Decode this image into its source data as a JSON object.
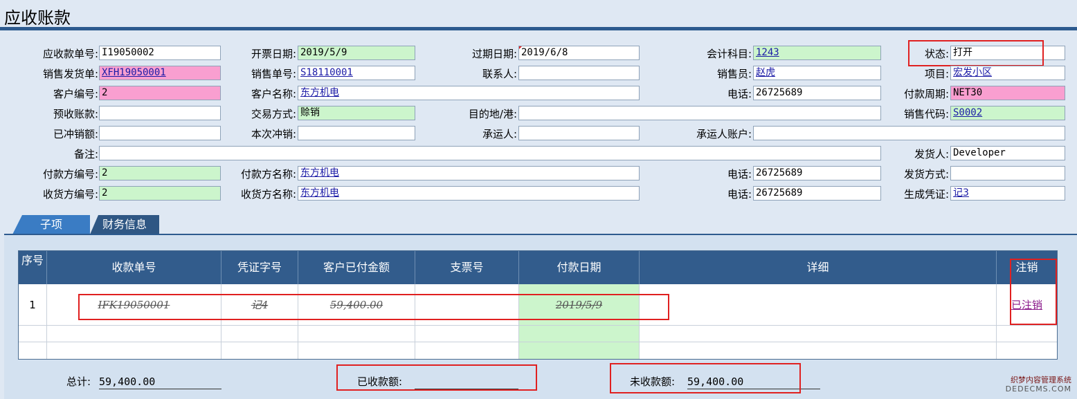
{
  "page_title": "应收账款",
  "form": {
    "receivable_no": {
      "label": "应收款单号:",
      "value": "I19050002"
    },
    "invoice_date": {
      "label": "开票日期:",
      "value": "2019/5/9"
    },
    "due_date": {
      "label": "过期日期:",
      "value": "2019/6/8"
    },
    "account_subject": {
      "label": "会计科目:",
      "value": "1243"
    },
    "status": {
      "label": "状态:",
      "value": "打开"
    },
    "sales_delivery": {
      "label": "销售发货单:",
      "value": "XFH19050001"
    },
    "sales_order": {
      "label": "销售单号:",
      "value": "S18110001"
    },
    "contact": {
      "label": "联系人:",
      "value": ""
    },
    "salesperson": {
      "label": "销售员:",
      "value": "赵虎"
    },
    "project": {
      "label": "项目:",
      "value": "宏发小区"
    },
    "customer_no": {
      "label": "客户编号:",
      "value": "2"
    },
    "customer_name": {
      "label": "客户名称:",
      "value": "东方机电"
    },
    "phone1": {
      "label": "电话:",
      "value": "26725689"
    },
    "payment_term": {
      "label": "付款周期:",
      "value": "NET30"
    },
    "prepaid": {
      "label": "预收账款:",
      "value": ""
    },
    "trade_mode": {
      "label": "交易方式:",
      "value": "赊销"
    },
    "destination": {
      "label": "目的地/港:",
      "value": ""
    },
    "sales_code": {
      "label": "销售代码:",
      "value": "S0002"
    },
    "offset_amount": {
      "label": "已冲销额:",
      "value": ""
    },
    "current_offset": {
      "label": "本次冲销:",
      "value": ""
    },
    "carrier": {
      "label": "承运人:",
      "value": ""
    },
    "carrier_account": {
      "label": "承运人账户:",
      "value": ""
    },
    "remark": {
      "label": "备注:",
      "value": ""
    },
    "shipper": {
      "label": "发货人:",
      "value": "Developer"
    },
    "payer_no": {
      "label": "付款方编号:",
      "value": "2"
    },
    "payer_name": {
      "label": "付款方名称:",
      "value": "东方机电"
    },
    "phone2": {
      "label": "电话:",
      "value": "26725689"
    },
    "ship_mode": {
      "label": "发货方式:",
      "value": ""
    },
    "receiver_no": {
      "label": "收货方编号:",
      "value": "2"
    },
    "receiver_name": {
      "label": "收货方名称:",
      "value": "东方机电"
    },
    "phone3": {
      "label": "电话:",
      "value": "26725689"
    },
    "voucher": {
      "label": "生成凭证:",
      "value": "记3"
    }
  },
  "tabs": [
    {
      "label": "子项"
    },
    {
      "label": "财务信息"
    }
  ],
  "table": {
    "headers": [
      "序号",
      "收款单号",
      "凭证字号",
      "客户已付金额",
      "支票号",
      "付款日期",
      "详细",
      "注销"
    ],
    "rows": [
      {
        "seq": "1",
        "receipt_no": "IFK19050001",
        "voucher_no": "记4",
        "amount": "59,400.00",
        "check_no": "",
        "pay_date": "2019/5/9",
        "detail": "",
        "cancel": "已注销"
      }
    ]
  },
  "totals": {
    "total_label": "总计:",
    "total_value": "59,400.00",
    "received_label": "已收款额:",
    "received_value": "",
    "unreceived_label": "未收款额:",
    "unreceived_value": "59,400.00"
  },
  "watermark": {
    "line1": "织梦内容管理系统",
    "line2": "DEDECMS.COM"
  }
}
